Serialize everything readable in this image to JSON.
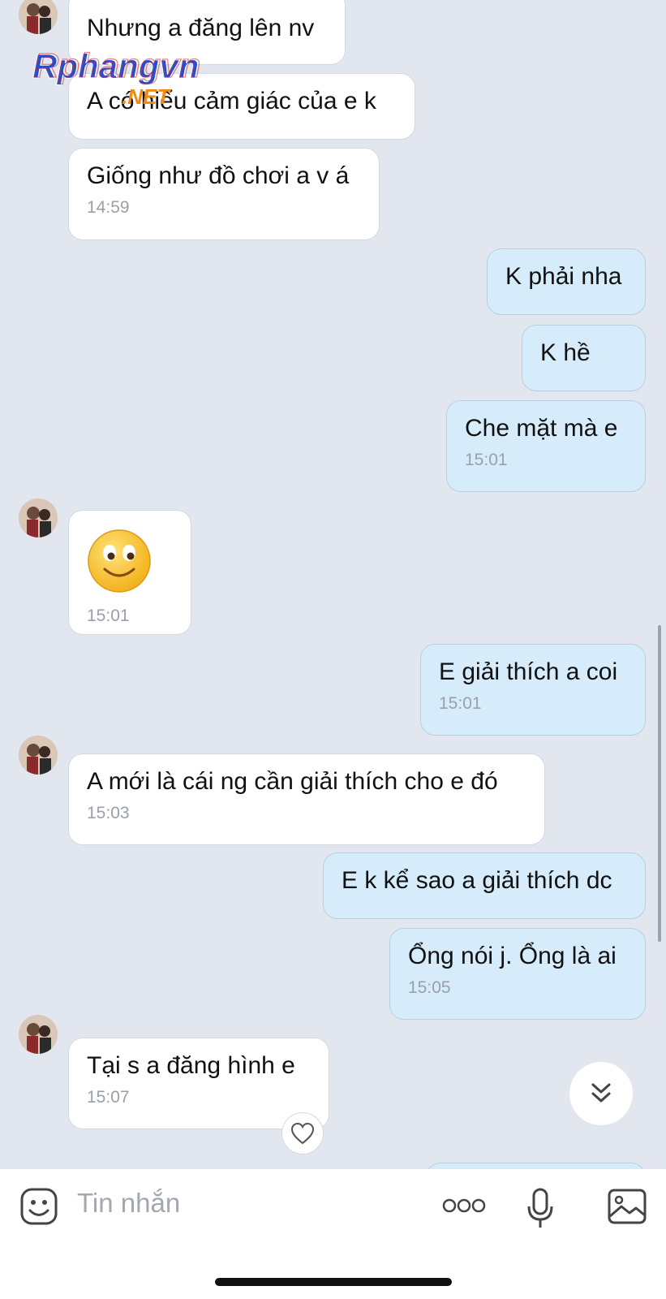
{
  "watermark": {
    "text_main": "Rphangvn",
    "text_sub": ".NET"
  },
  "messages": [
    {
      "text": "Nhưng a đăng lên nv"
    },
    {
      "text": "A có hiểu cảm giác của e k"
    },
    {
      "text": "Giống như đồ chơi a v á",
      "time": "14:59"
    },
    {
      "text": "K phải nha"
    },
    {
      "text": "K hề"
    },
    {
      "text": "Che mặt mà e",
      "time": "15:01"
    },
    {
      "text": "🙂",
      "time": "15:01"
    },
    {
      "text": "E giải thích a coi",
      "time": "15:01"
    },
    {
      "text": "A mới là cái ng cần giải thích cho e đó",
      "time": "15:03"
    },
    {
      "text": "E k kể sao a giải thích dc"
    },
    {
      "text": "Ổng nói j. Ổng là ai",
      "time": "15:05"
    },
    {
      "text": "Tại s a đăng hình e",
      "time": "15:07"
    }
  ],
  "composer": {
    "placeholder": "Tin nhắn",
    "icons": [
      "sticker-icon",
      "more-icon",
      "microphone-icon",
      "image-icon"
    ]
  },
  "colors": {
    "background": "#e2e6ef",
    "incoming": "#ffffff",
    "outgoing": "#d6ecfb",
    "time": "#9aa0a8"
  }
}
